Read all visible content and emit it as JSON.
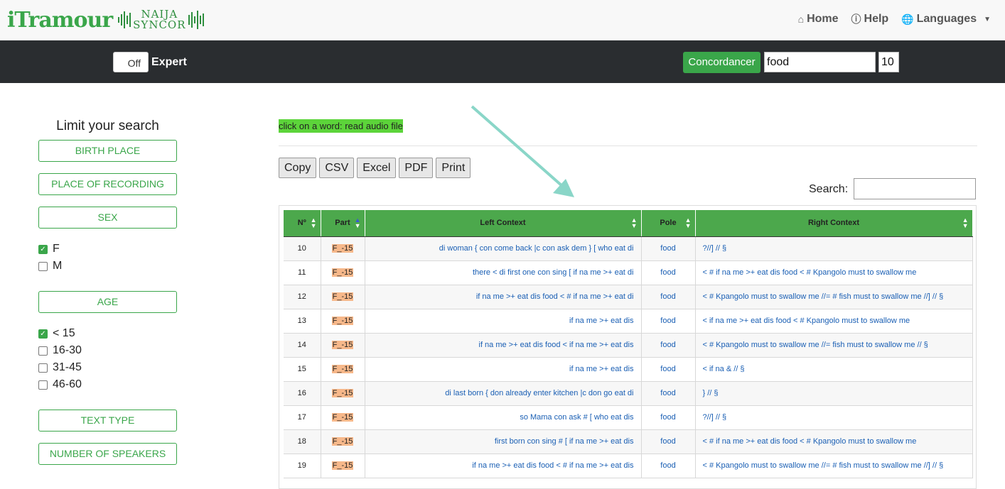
{
  "header": {
    "logo_text_1": "iTramour",
    "logo_text_2": "NAIJA",
    "logo_text_3": "SYNCOR",
    "nav": [
      {
        "label": "Home",
        "icon": "home-icon"
      },
      {
        "label": "Help",
        "icon": "info-icon"
      },
      {
        "label": "Languages",
        "icon": "globe-icon"
      }
    ]
  },
  "toolbar": {
    "toggle_label": "Off",
    "expert_label": "Expert",
    "concordancer_label": "Concordancer",
    "query": "food",
    "limit": "10"
  },
  "sidebar": {
    "title": "Limit your search",
    "filters": {
      "birth_place": "BIRTH PLACE",
      "place_of_recording": "PLACE OF RECORDING",
      "sex": "SEX",
      "age": "AGE",
      "text_type": "TEXT TYPE",
      "number_of_speakers": "NUMBER OF SPEAKERS"
    },
    "sex_options": [
      {
        "label": "F",
        "checked": true
      },
      {
        "label": "M",
        "checked": false
      }
    ],
    "age_options": [
      {
        "label": "< 15",
        "checked": true
      },
      {
        "label": "16-30",
        "checked": false
      },
      {
        "label": "31-45",
        "checked": false
      },
      {
        "label": "46-60",
        "checked": false
      }
    ]
  },
  "main": {
    "hint": "click on a word: read audio file",
    "export_buttons": [
      "Copy",
      "CSV",
      "Excel",
      "PDF",
      "Print"
    ],
    "search_label": "Search:"
  },
  "table": {
    "headers": [
      "Nº",
      "Part",
      "Left Context",
      "Pole",
      "Right Context"
    ],
    "rows": [
      [
        "10",
        "F_-15",
        "di woman { con come back |c con ask dem } [ who eat di",
        "food",
        "?//] // §"
      ],
      [
        "11",
        "F_-15",
        "there < di first one con sing [ if na me >+ eat di",
        "food",
        "< # if na me >+ eat dis food < # Kpangolo must to swallow me"
      ],
      [
        "12",
        "F_-15",
        "if na me >+ eat dis food < # if na me >+ eat di",
        "food",
        "< # Kpangolo must to swallow me //= # fish must to swallow me //] // §"
      ],
      [
        "13",
        "F_-15",
        "if na me >+ eat dis",
        "food",
        "< if na me >+ eat dis food < # Kpangolo must to swallow me"
      ],
      [
        "14",
        "F_-15",
        "if na me >+ eat dis food < if na me >+ eat dis",
        "food",
        "< # Kpangolo must to swallow me //= fish must to swallow me // §"
      ],
      [
        "15",
        "F_-15",
        "if na me >+ eat dis",
        "food",
        "< if na & // §"
      ],
      [
        "16",
        "F_-15",
        "di last born { don already enter kitchen |c don go eat di",
        "food",
        "} // §"
      ],
      [
        "17",
        "F_-15",
        "so Mama con ask # [ who eat dis",
        "food",
        "?//] // §"
      ],
      [
        "18",
        "F_-15",
        "first born con sing # [ if na me >+ eat dis",
        "food",
        "< # if na me >+ eat dis food < # Kpangolo must to swallow me"
      ],
      [
        "19",
        "F_-15",
        "if na me >+ eat dis food < # if na me >+ eat dis",
        "food",
        "< # Kpangolo must to swallow me //= # fish must to swallow me //] // §"
      ]
    ]
  },
  "colors": {
    "accent": "#3aa64a",
    "dark_bar": "#2a2d30",
    "header_green": "#4ca84c",
    "link_blue": "#1a5fb4",
    "highlight": "#f7b88a",
    "hint_bg": "#5cd43a"
  }
}
